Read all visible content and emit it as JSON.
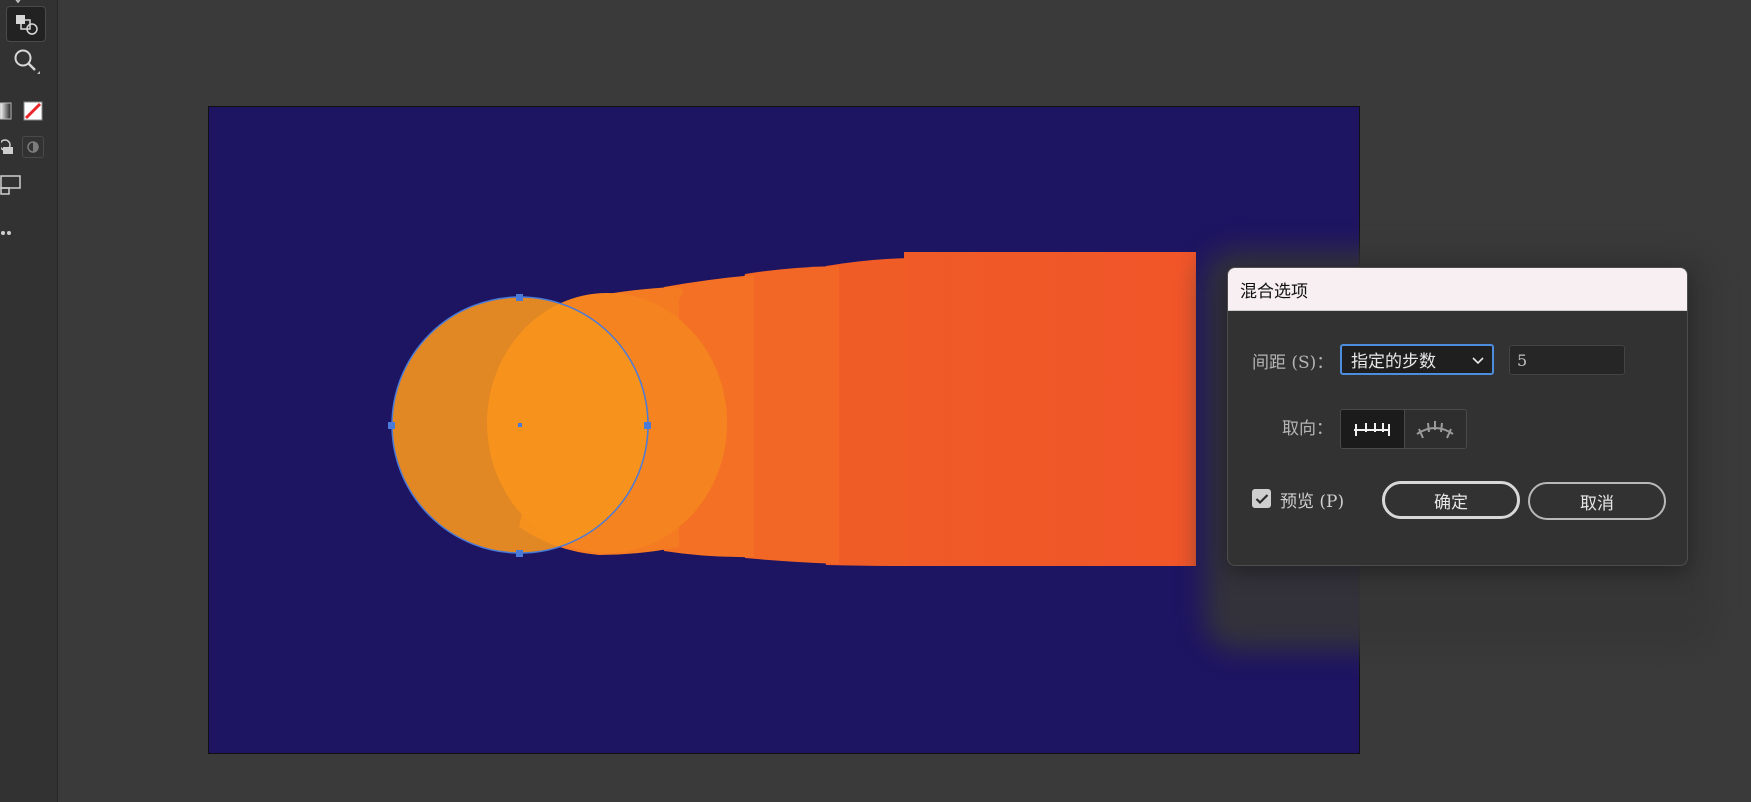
{
  "dialog": {
    "title": "混合选项",
    "spacing_label": "间距 (S)：",
    "spacing_option": "指定的步数",
    "steps_value": "5",
    "orientation_label": "取向：",
    "orientation_options": [
      "align-to-page",
      "align-to-path"
    ],
    "orientation_selected": "align-to-page",
    "preview_label": "预览 (P)",
    "preview_checked": true,
    "ok_label": "确定",
    "cancel_label": "取消"
  },
  "toolbar": {
    "tools": [
      "shape-builder-icon",
      "zoom-icon",
      "fill-stroke-icon",
      "none-swatch-icon",
      "draw-mode-icon",
      "screen-mode-icon",
      "more-tools-icon"
    ]
  },
  "canvas": {
    "artboard_color": "#1d1462",
    "blend_start_color": "#f7941d",
    "blend_end_color": "#f15a29",
    "selection_color": "#4a7bd8"
  }
}
